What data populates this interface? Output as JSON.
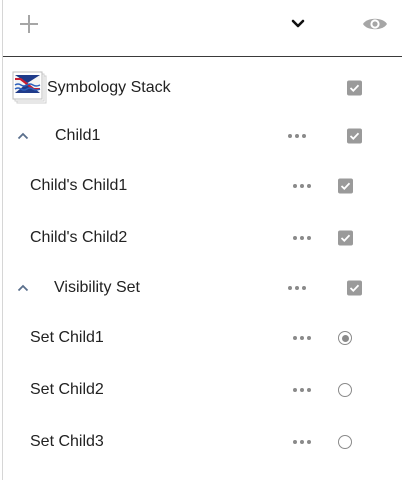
{
  "toolbar": {
    "add_icon": "plus-icon",
    "collapse_icon": "chevron-down-icon",
    "visibility_icon": "eye-icon"
  },
  "tree": {
    "root": {
      "label": "Symbology Stack",
      "checked": true,
      "icon": "layer-stack-thumbnail"
    },
    "child1": {
      "label": "Child1",
      "checked": true,
      "expanded": true
    },
    "child1_children": [
      {
        "label": "Child's Child1",
        "checked": true
      },
      {
        "label": "Child's Child2",
        "checked": true
      }
    ],
    "visibility_set": {
      "label": "Visibility Set",
      "checked": true,
      "expanded": true
    },
    "set_children": [
      {
        "label": "Set Child1",
        "selected": true
      },
      {
        "label": "Set Child2",
        "selected": false
      },
      {
        "label": "Set Child3",
        "selected": false
      }
    ]
  },
  "colors": {
    "icon_gray": "#9a9a9a",
    "caret_blue": "#5a6f8c",
    "divider": "#3a3a3a"
  }
}
